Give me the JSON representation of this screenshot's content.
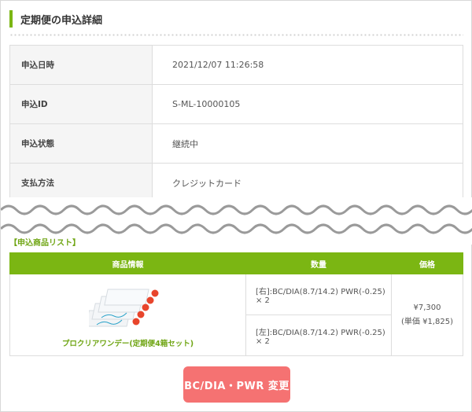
{
  "header": {
    "title": "定期便の申込詳細"
  },
  "details": [
    {
      "label": "申込日時",
      "value": "2021/12/07 11:26:58"
    },
    {
      "label": "申込ID",
      "value": "S-ML-10000105"
    },
    {
      "label": "申込状態",
      "value": "継続中"
    },
    {
      "label": "支払方法",
      "value": "クレジットカード"
    }
  ],
  "product_list": {
    "label": "【申込商品リスト】",
    "columns": [
      "商品情報",
      "数量",
      "価格"
    ],
    "item": {
      "name": "プロクリアワンデー(定期便4箱セット)",
      "image_icon": "contact-lens-boxes-image",
      "quantities": [
        "[右]:BC/DIA(8.7/14.2) PWR(-0.25) × 2",
        "[左]:BC/DIA(8.7/14.2) PWR(-0.25) × 2"
      ],
      "price": "¥7,300",
      "unit_price": "(単価 ¥1,825)"
    }
  },
  "change_button": {
    "label": "BC/DIA・PWR 変更"
  },
  "colors": {
    "accent": "#7bb613",
    "button": "#f57272"
  }
}
